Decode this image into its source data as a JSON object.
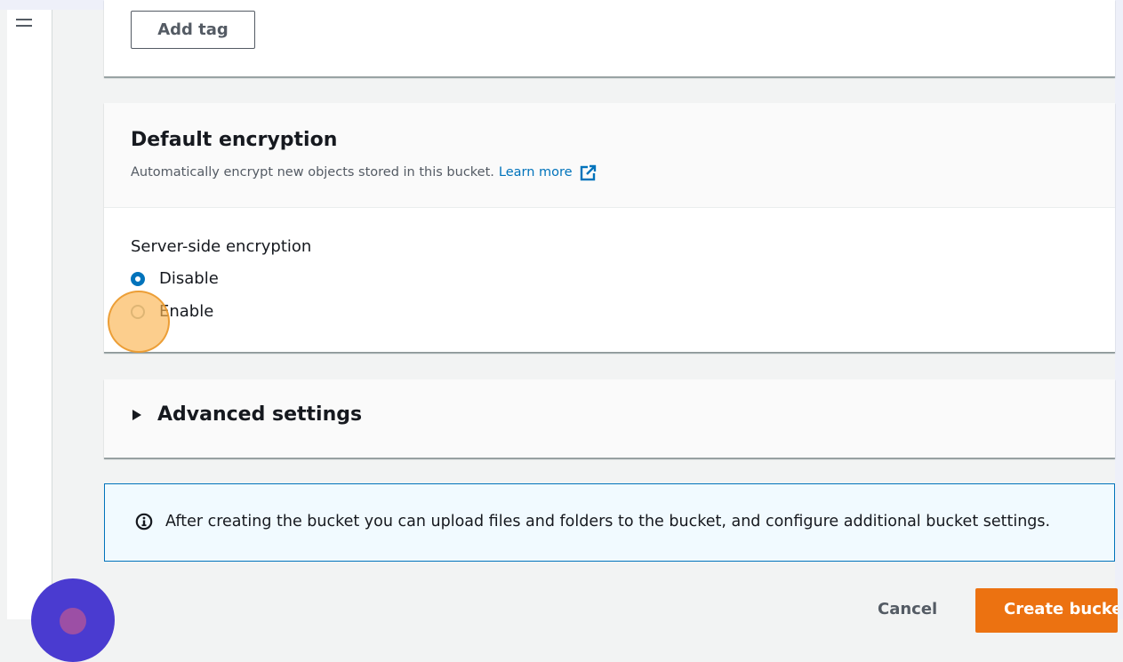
{
  "tags_section": {
    "add_tag_label": "Add tag"
  },
  "encryption": {
    "title": "Default encryption",
    "description": "Automatically encrypt new objects stored in this bucket.",
    "learn_more": "Learn more",
    "label": "Server-side encryption",
    "options": [
      {
        "label": "Disable",
        "selected": true
      },
      {
        "label": "Enable",
        "selected": false
      }
    ]
  },
  "advanced": {
    "title": "Advanced settings",
    "expanded": false
  },
  "info": {
    "text": "After creating the bucket you can upload files and folders to the bucket, and configure additional bucket settings."
  },
  "footer": {
    "cancel_label": "Cancel",
    "create_label": "Create bucket"
  },
  "icons": {
    "menu": "hamburger-icon",
    "external": "external-link-icon",
    "info": "info-icon",
    "caret": "caret-right-icon"
  },
  "colors": {
    "accent": "#0073bb",
    "primary": "#ec7211",
    "click_highlight": "#fab450",
    "avatar": "#4a3bd0"
  }
}
